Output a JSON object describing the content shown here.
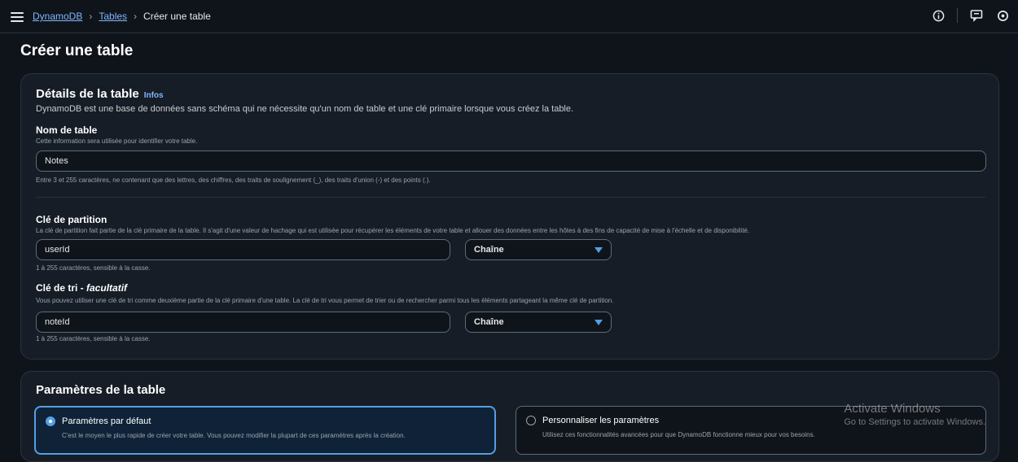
{
  "breadcrumb": {
    "root": "DynamoDB",
    "tables": "Tables",
    "current": "Créer une table"
  },
  "page_title": "Créer une table",
  "table_details": {
    "title": "Détails de la table",
    "infos": "Infos",
    "description": "DynamoDB est une base de données sans schéma qui ne nécessite qu'un nom de table et une clé primaire lorsque vous créez la table.",
    "table_name": {
      "label": "Nom de table",
      "description": "Cette information sera utilisée pour identifier votre table.",
      "value": "Notes",
      "hint": "Entre 3 et 255 caractères, ne contenant que des lettres, des chiffres, des traits de soulignement (_), des traits d'union (-) et des points (.)."
    },
    "partition_key": {
      "label": "Clé de partition",
      "description": "La clé de partition fait partie de la clé primaire de la table. Il s'agit d'une valeur de hachage qui est utilisée pour récupérer les éléments de votre table et allouer des données entre les hôtes à des fins de capacité de mise à l'échelle et de disponibilité.",
      "value": "userId",
      "type": "Chaîne",
      "hint": "1 à 255 caractères, sensible à la casse."
    },
    "sort_key": {
      "label": "Clé de tri - ",
      "label_optional": "facultatif",
      "description": "Vous pouvez utiliser une clé de tri comme deuxième partie de la clé primaire d'une table. La clé de tri vous permet de trier ou de rechercher parmi tous les éléments partageant la même clé de partition.",
      "value": "noteId",
      "type": "Chaîne",
      "hint": "1 à 255 caractères, sensible à la casse."
    }
  },
  "table_settings": {
    "title": "Paramètres de la table",
    "default_option": {
      "label": "Paramètres par défaut",
      "description": "C'est le moyen le plus rapide de créer votre table. Vous pouvez modifier la plupart de ces paramètres après la création."
    },
    "custom_option": {
      "label": "Personnaliser les paramètres",
      "description": "Utilisez ces fonctionnalités avancées pour que DynamoDB fonctionne mieux pour vos besoins."
    }
  },
  "watermark": {
    "line1": "Activate Windows",
    "line2": "Go to Settings to activate Windows."
  },
  "colors": {
    "accent": "#539fe5",
    "link": "#7fb8ff",
    "background": "#0f141a",
    "panel": "#161d26"
  },
  "icons": [
    "menu-icon",
    "info-icon",
    "feedback-icon",
    "settings-icon",
    "caret-down-icon"
  ]
}
